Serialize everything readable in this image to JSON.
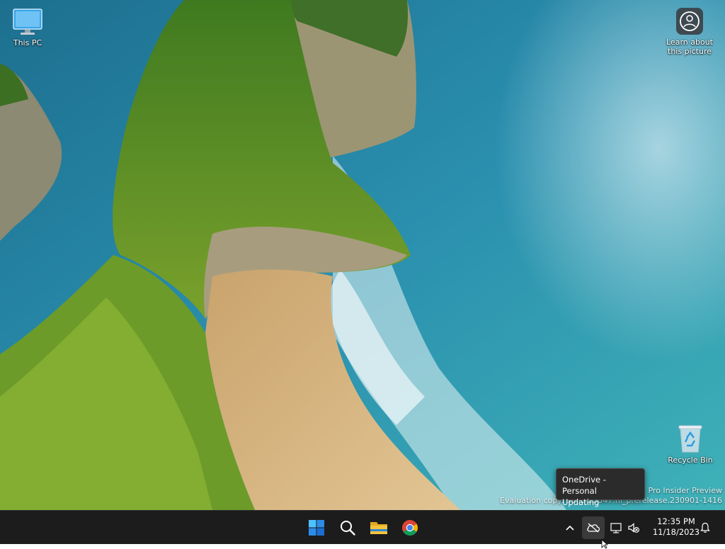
{
  "desktop": {
    "icons": {
      "this_pc": "This PC",
      "learn": "Learn about this picture",
      "recycle_bin": "Recycle Bin"
    },
    "watermark": {
      "line1": "Windows 11 Pro Insider Preview",
      "line2": "Evaluation copy. Build 23547.ni_prerelease.230901-1416"
    }
  },
  "tooltip": {
    "title": "OneDrive - Personal",
    "status": "Updating"
  },
  "taskbar": {
    "apps": [
      "start-icon",
      "search-icon",
      "file-explorer-icon",
      "chrome-icon"
    ],
    "tray": [
      "chevron-up-icon",
      "onedrive-icon",
      "network-icon",
      "volume-muted-icon",
      "notification-bell-icon"
    ],
    "clock": {
      "time": "12:35 PM",
      "date": "11/18/2023"
    }
  },
  "colors": {
    "taskbar_bg": "#1c1c1c",
    "start_blue": "#2b8de8",
    "folder_yellow": "#f3c33b",
    "ocean": "#1e8aa8",
    "cliff_green": "#4d8a24",
    "sand": "#d8b680"
  }
}
